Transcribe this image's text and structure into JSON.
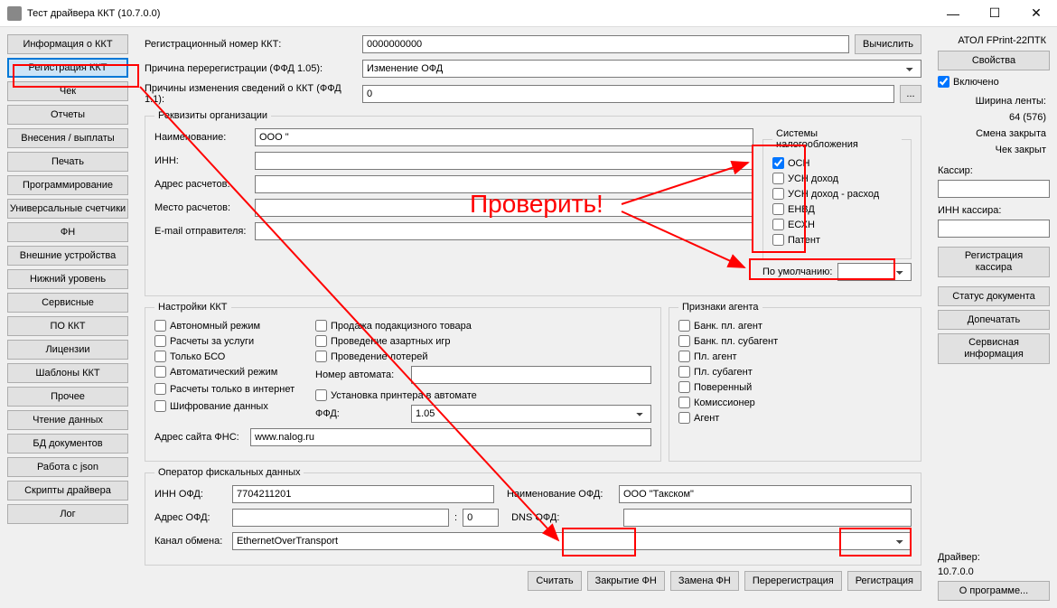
{
  "window": {
    "title": "Тест драйвера ККТ (10.7.0.0)"
  },
  "sidebar": {
    "items": [
      {
        "label": "Информация о ККТ"
      },
      {
        "label": "Регистрация ККТ"
      },
      {
        "label": "Чек"
      },
      {
        "label": "Отчеты"
      },
      {
        "label": "Внесения / выплаты"
      },
      {
        "label": "Печать"
      },
      {
        "label": "Программирование"
      },
      {
        "label": "Универсальные счетчики"
      },
      {
        "label": "ФН"
      },
      {
        "label": "Внешние устройства"
      },
      {
        "label": "Нижний уровень"
      },
      {
        "label": "Сервисные"
      },
      {
        "label": "ПО ККТ"
      },
      {
        "label": "Лицензии"
      },
      {
        "label": "Шаблоны ККТ"
      },
      {
        "label": "Прочее"
      },
      {
        "label": "Чтение данных"
      },
      {
        "label": "БД документов"
      },
      {
        "label": "Работа с json"
      },
      {
        "label": "Скрипты драйвера"
      },
      {
        "label": "Лог"
      }
    ]
  },
  "top": {
    "reg_num_label": "Регистрационный номер ККТ:",
    "reg_num_value": "0000000000",
    "calc_btn": "Вычислить",
    "rereg_reason_label": "Причина перерегистрации (ФФД 1.05):",
    "rereg_reason_value": "Изменение ОФД",
    "change_reason_label": "Причины изменения сведений о ККТ (ФФД 1.1):",
    "change_reason_value": "0",
    "dots": "..."
  },
  "org": {
    "legend": "Реквизиты организации",
    "name_label": "Наименование:",
    "name_value": "ООО \"",
    "inn_label": "ИНН:",
    "inn_value": "",
    "addr_calc_label": "Адрес расчетов:",
    "addr_calc_value": "",
    "place_calc_label": "Место расчетов:",
    "place_calc_value": "",
    "email_label": "E-mail отправителя:",
    "email_value": "",
    "tax_legend": "Системы налогообложения",
    "tax_items": [
      {
        "label": "ОСН",
        "checked": true
      },
      {
        "label": "УСН доход",
        "checked": false
      },
      {
        "label": "УСН доход - расход",
        "checked": false
      },
      {
        "label": "ЕНВД",
        "checked": false
      },
      {
        "label": "ЕСХН",
        "checked": false
      },
      {
        "label": "Патент",
        "checked": false
      }
    ],
    "default_label": "По умолчанию:",
    "default_value": ""
  },
  "kkt": {
    "legend": "Настройки ККТ",
    "col1": [
      "Автономный режим",
      "Расчеты за услуги",
      "Только БСО",
      "Автоматический режим",
      "Расчеты только в интернет",
      "Шифрование данных"
    ],
    "col2": [
      "Продажа подакцизного товара",
      "Проведение азартных игр",
      "Проведение лотерей"
    ],
    "machine_num_label": "Номер автомата:",
    "machine_num_value": "",
    "printer_install": "Установка принтера в автомате",
    "ffd_label": "ФФД:",
    "ffd_value": "1.05",
    "fns_label": "Адрес сайта ФНС:",
    "fns_value": "www.nalog.ru"
  },
  "agent": {
    "legend": "Признаки агента",
    "items": [
      "Банк. пл. агент",
      "Банк. пл. субагент",
      "Пл. агент",
      "Пл. субагент",
      "Поверенный",
      "Комиссионер",
      "Агент"
    ]
  },
  "ofd": {
    "legend": "Оператор фискальных данных",
    "inn_label": "ИНН ОФД:",
    "inn_value": "7704211201",
    "name_label": "Наименование ОФД:",
    "name_value": "ООО \"Такском\"",
    "addr_label": "Адрес ОФД:",
    "addr_value": "",
    "port_value": "0",
    "dns_label": "DNS ОФД:",
    "dns_value": "",
    "channel_label": "Канал обмена:",
    "channel_value": "EthernetOverTransport"
  },
  "actions": {
    "read": "Считать",
    "close_fn": "Закрытие ФН",
    "replace_fn": "Замена ФН",
    "rereg": "Перерегистрация",
    "reg": "Регистрация"
  },
  "right": {
    "device": "АТОЛ FPrint-22ПТК",
    "props_btn": "Свойства",
    "enabled_label": "Включено",
    "tape_width": "Ширина ленты:",
    "tape_width_val": "64 (576)",
    "shift_closed": "Смена закрыта",
    "check_closed": "Чек закрыт",
    "cashier_label": "Кассир:",
    "cashier_inn_label": "ИНН кассира:",
    "reg_cashier_btn": "Регистрация кассира",
    "doc_status_btn": "Статус документа",
    "reprint_btn": "Допечатать",
    "service_info_btn": "Сервисная информация",
    "driver_label": "Драйвер:",
    "driver_ver": "10.7.0.0",
    "about_btn": "О программе..."
  },
  "annot": {
    "check": "Проверить!"
  }
}
